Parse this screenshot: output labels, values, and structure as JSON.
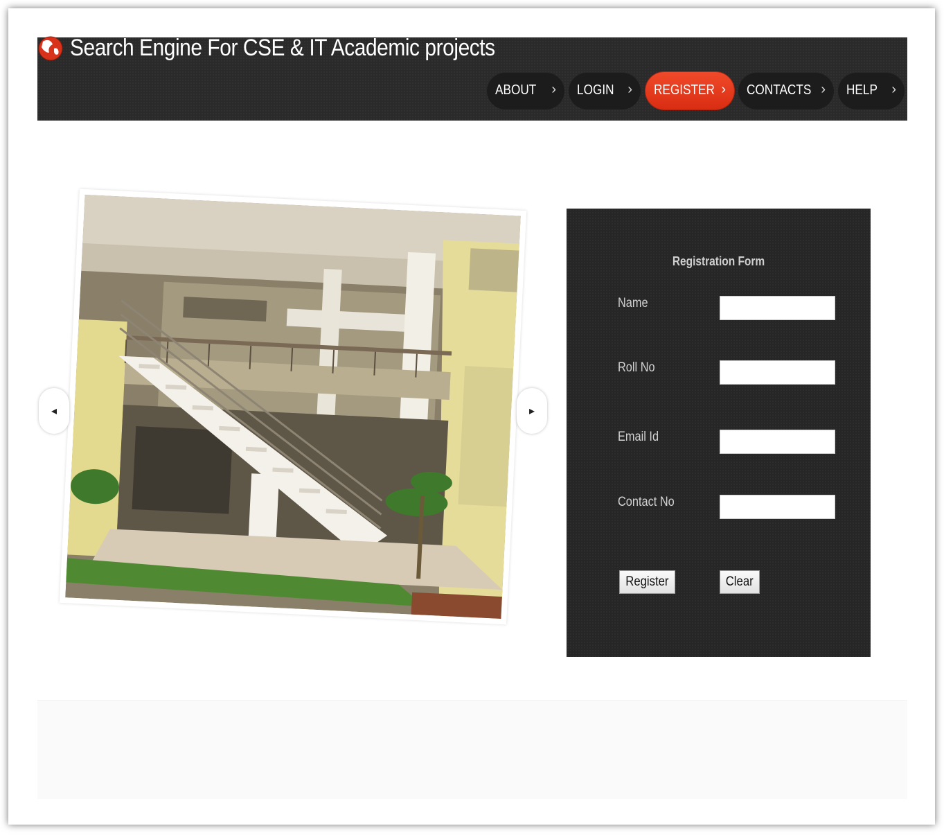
{
  "header": {
    "title": "Search Engine For CSE & IT Academic projects",
    "logo_icon": "globe-logo-icon"
  },
  "nav": {
    "items": [
      {
        "label": "ABOUT",
        "active": false
      },
      {
        "label": "LOGIN",
        "active": false
      },
      {
        "label": "REGISTER",
        "active": true
      },
      {
        "label": "CONTACTS",
        "active": false
      },
      {
        "label": "HELP",
        "active": false
      }
    ],
    "chevron": "›",
    "active_color": "#e8351a"
  },
  "slider": {
    "prev_icon": "◂",
    "next_icon": "▸"
  },
  "form": {
    "title": "Registration Form",
    "fields": [
      {
        "label": "Name",
        "value": ""
      },
      {
        "label": "Roll No",
        "value": ""
      },
      {
        "label": "Email Id",
        "value": ""
      },
      {
        "label": "Contact No",
        "value": ""
      }
    ],
    "register_label": "Register",
    "clear_label": "Clear"
  }
}
